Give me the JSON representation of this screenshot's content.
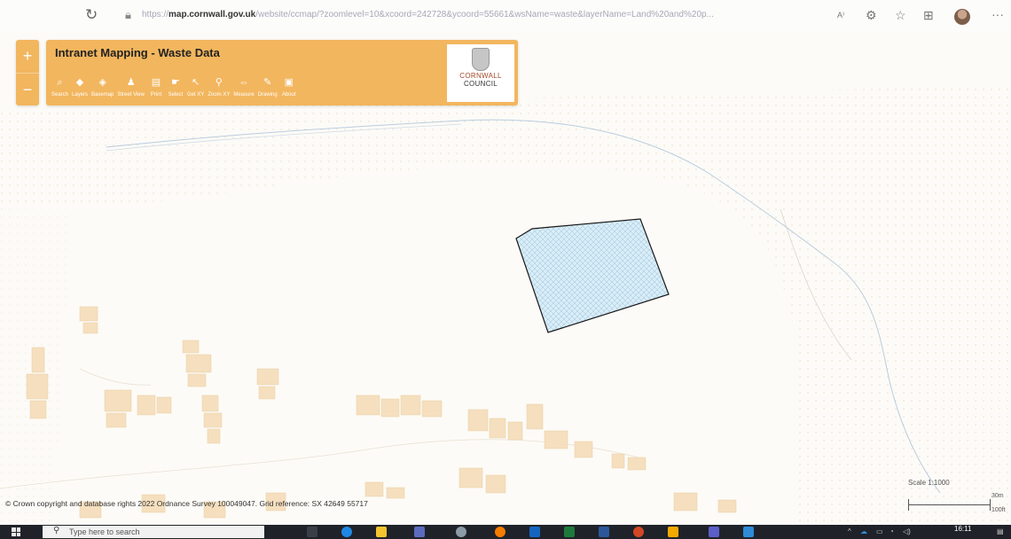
{
  "browser": {
    "url_bold": "map.cornwall.gov.uk",
    "url_prefix": "https://",
    "url_rest": "/website/ccmap/?zoomlevel=10&xcoord=242728&ycoord=55661&wsName=waste&layerName=Land%20and%20p...",
    "icons": [
      "refresh-icon",
      "lock-icon",
      "read-aloud-icon",
      "extensions-icon",
      "favorites-icon",
      "collections-icon",
      "profile-avatar",
      "more-icon"
    ]
  },
  "map": {
    "zoom_in": "+",
    "zoom_out": "−",
    "polygon_fill": "#dbeef8",
    "polygon_stroke": "#1a1a1a",
    "building_color": "#f5dfbe",
    "accent": "#f2b65e"
  },
  "toolbar": {
    "title": "Intranet Mapping - Waste Data",
    "tools": [
      {
        "label": "Search",
        "icon": "search-icon"
      },
      {
        "label": "Layers",
        "icon": "layers-icon"
      },
      {
        "label": "Basemap",
        "icon": "basemap-icon"
      },
      {
        "label": "Street View",
        "icon": "street-view-icon"
      },
      {
        "label": "Print",
        "icon": "print-icon"
      },
      {
        "label": "Select",
        "icon": "select-icon"
      },
      {
        "label": "Get XY",
        "icon": "get-xy-icon"
      },
      {
        "label": "Zoom XY",
        "icon": "zoom-xy-icon"
      },
      {
        "label": "Measure",
        "icon": "measure-icon"
      },
      {
        "label": "Drawing",
        "icon": "drawing-icon"
      },
      {
        "label": "About",
        "icon": "about-icon"
      }
    ]
  },
  "logo": {
    "line1": "CORNWALL",
    "line2": "COUNCIL"
  },
  "footer": {
    "copyright": "© Crown copyright and database rights 2022 Ordnance Survey 100049047.  Grid reference:  SX 42649 55717",
    "scale": "Scale 1:1000",
    "scale_m": "30m",
    "scale_ft": "100ft"
  },
  "taskbar": {
    "search_placeholder": "Type here to search",
    "time": "16:11"
  }
}
